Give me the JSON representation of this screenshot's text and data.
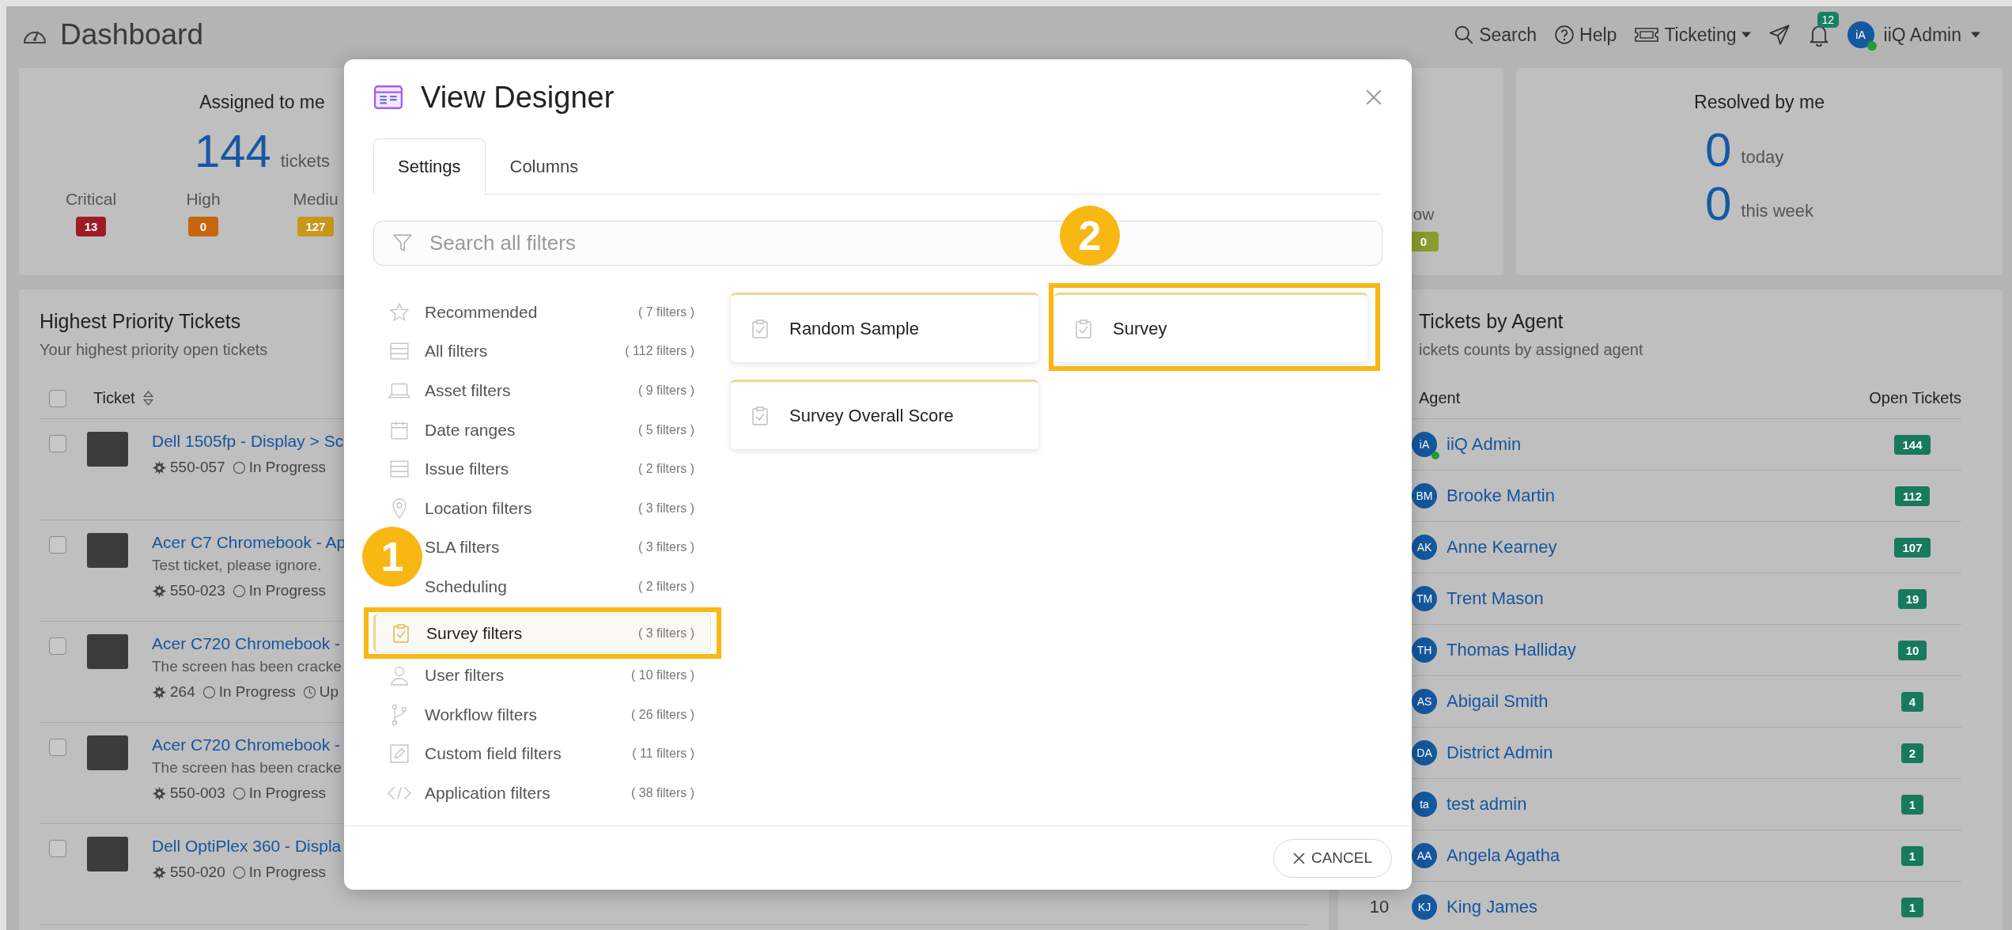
{
  "header": {
    "title": "Dashboard",
    "search": "Search",
    "help": "Help",
    "module": "Ticketing",
    "notifications": "12",
    "user": {
      "initials": "iA",
      "name": "iiQ Admin",
      "online": true
    }
  },
  "assigned_card": {
    "title": "Assigned to me",
    "total": "144",
    "unit": "tickets",
    "priorities": [
      {
        "label": "Critical",
        "count": "13",
        "color": "#9e1c26"
      },
      {
        "label": "High",
        "count": "0",
        "color": "#c6660f"
      },
      {
        "label": "Mediu",
        "count": "127",
        "color": "#c9971b"
      }
    ]
  },
  "card_3": {
    "priorities": [
      {
        "label": "ow",
        "count": "0",
        "color": "#8c9c2c"
      }
    ]
  },
  "resolved_card": {
    "title": "Resolved by me",
    "stats": [
      {
        "value": "0",
        "label": "today"
      },
      {
        "value": "0",
        "label": "this week"
      }
    ]
  },
  "priority_tickets": {
    "title": "Highest Priority Tickets",
    "subtitle": "Your highest priority open tickets",
    "column": "Ticket",
    "checked": false,
    "tickets": [
      {
        "checked": false,
        "title": "Dell 1505fp - Display > Sc",
        "id": "550-057",
        "status": "In Progress"
      },
      {
        "checked": false,
        "title": "Acer C7 Chromebook - Ap",
        "description": "Test ticket, please ignore.",
        "id": "550-023",
        "status": "In Progress"
      },
      {
        "checked": false,
        "title": "Acer C720 Chromebook -",
        "description": "The screen has been cracke",
        "id": "264",
        "status": "In Progress",
        "extra": "Up"
      },
      {
        "checked": false,
        "title": "Acer C720 Chromebook -",
        "description": "The screen has been cracke",
        "id": "550-003",
        "status": "In Progress"
      },
      {
        "checked": false,
        "title": "Dell OptiPlex 360 - Displa",
        "id": "550-020",
        "status": "In Progress"
      }
    ]
  },
  "agents_panel": {
    "title": "Tickets by Agent",
    "subtitle": "ickets counts by assigned agent",
    "columns": [
      "Agent",
      "Open Tickets"
    ],
    "agents": [
      {
        "initials": "iA",
        "name": "iiQ Admin",
        "count": "144",
        "online": true
      },
      {
        "initials": "BM",
        "name": "Brooke Martin",
        "count": "112",
        "online": false
      },
      {
        "initials": "AK",
        "name": "Anne Kearney",
        "count": "107",
        "online": false
      },
      {
        "initials": "TM",
        "name": "Trent Mason",
        "count": "19",
        "online": false
      },
      {
        "initials": "TH",
        "name": "Thomas Halliday",
        "count": "10",
        "online": false
      },
      {
        "initials": "AS",
        "name": "Abigail Smith",
        "count": "4",
        "online": false
      },
      {
        "initials": "DA",
        "name": "District Admin",
        "count": "2",
        "online": false
      },
      {
        "initials": "ta",
        "name": "test admin",
        "count": "1",
        "online": false
      },
      {
        "initials": "AA",
        "name": "Angela Agatha",
        "count": "1",
        "online": false
      },
      {
        "rank": "10",
        "initials": "KJ",
        "name": "King James",
        "count": "1",
        "online": false
      }
    ]
  },
  "modal": {
    "title": "View Designer",
    "tabs": [
      {
        "label": "Settings",
        "selected": true
      },
      {
        "label": "Columns",
        "selected": false
      }
    ],
    "search": {
      "placeholder": "Search all filters"
    },
    "categories": [
      {
        "kind": "star",
        "label": "Recommended",
        "count": "( 7 filters )",
        "selected": false
      },
      {
        "kind": "stack",
        "label": "All filters",
        "count": "( 112 filters )",
        "selected": false
      },
      {
        "kind": "laptop",
        "label": "Asset filters",
        "count": "( 9 filters )",
        "selected": false
      },
      {
        "kind": "calendar",
        "label": "Date ranges",
        "count": "( 5 filters )",
        "selected": false
      },
      {
        "kind": "stack",
        "label": "Issue filters",
        "count": "( 2 filters )",
        "selected": false
      },
      {
        "kind": "pin",
        "label": "Location filters",
        "count": "( 3 filters )",
        "selected": false
      },
      {
        "kind": "covered",
        "label": "SLA filters",
        "count": "( 3 filters )",
        "selected": false
      },
      {
        "kind": "covered",
        "label": "Scheduling",
        "count": "( 2 filters )",
        "selected": false
      },
      {
        "kind": "clipboard",
        "label": "Survey filters",
        "count": "( 3 filters )",
        "selected": true,
        "callout": "1"
      },
      {
        "kind": "person",
        "label": "User filters",
        "count": "( 10 filters )",
        "selected": false
      },
      {
        "kind": "branch",
        "label": "Workflow filters",
        "count": "( 26 filters )",
        "selected": false
      },
      {
        "kind": "pencil",
        "label": "Custom field filters",
        "count": "( 11 filters )",
        "selected": false
      },
      {
        "kind": "code",
        "label": "Application filters",
        "count": "( 38 filters )",
        "selected": false
      }
    ],
    "filters": [
      {
        "label": "Random Sample"
      },
      {
        "label": "Survey",
        "callout": "2"
      },
      {
        "label": "Survey Overall Score"
      }
    ],
    "cancel": "CANCEL"
  }
}
